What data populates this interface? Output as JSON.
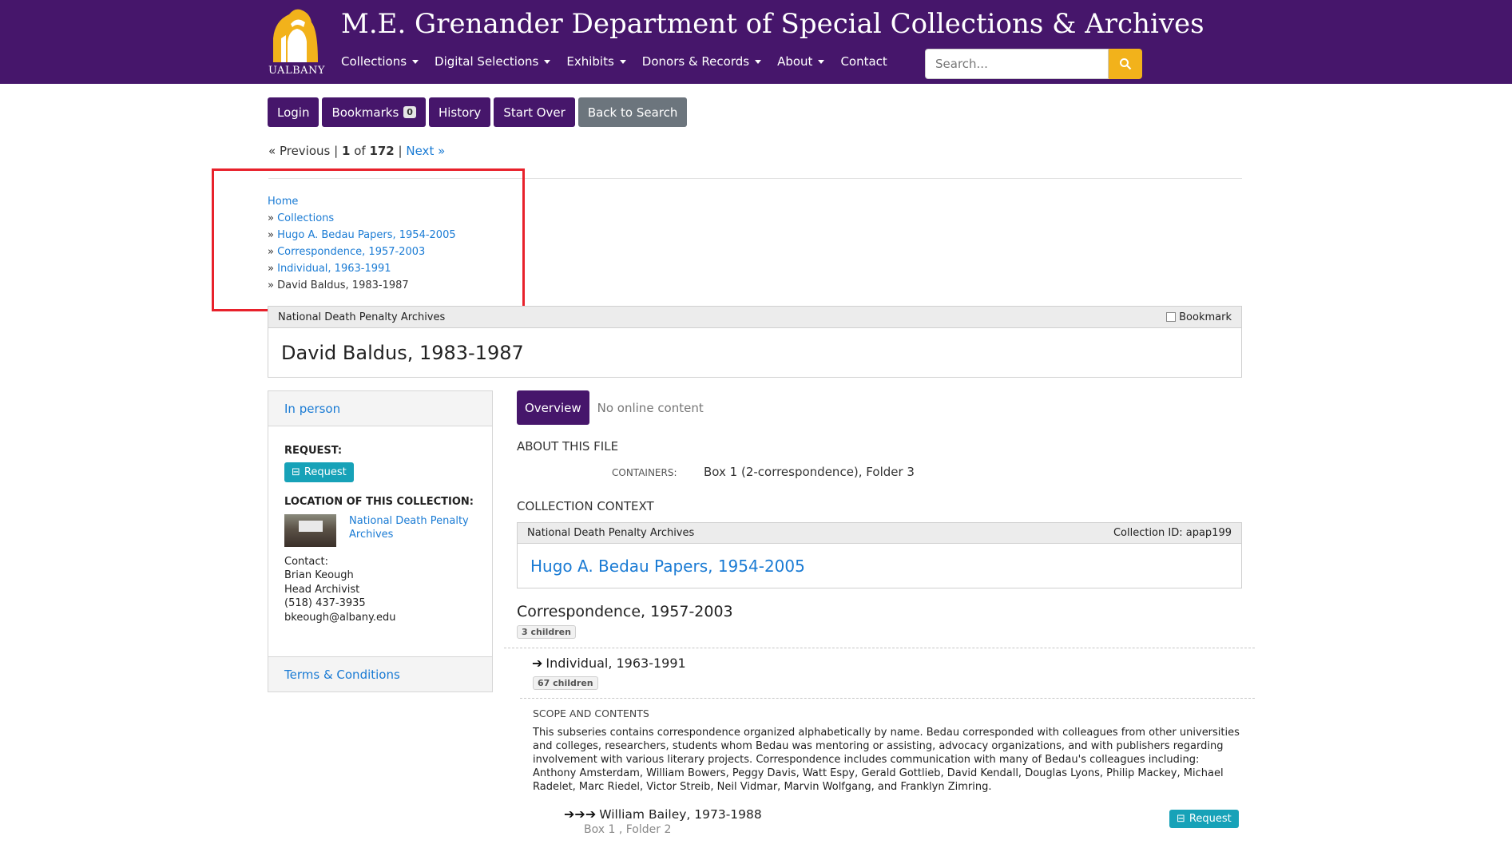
{
  "header": {
    "logo_text": "UALBANY",
    "site_title": "M.E. Grenander Department of Special Collections & Archives",
    "nav": [
      {
        "label": "Collections"
      },
      {
        "label": "Digital Selections"
      },
      {
        "label": "Exhibits"
      },
      {
        "label": "Donors & Records"
      },
      {
        "label": "About"
      },
      {
        "label": "Contact"
      }
    ],
    "search_placeholder": "Search...",
    "colors": {
      "brand": "#46166b",
      "gold": "#f2b21b"
    }
  },
  "toolbar": {
    "login": "Login",
    "bookmarks": "Bookmarks",
    "bookmarks_count": "0",
    "history": "History",
    "start_over": "Start Over",
    "back_to_search": "Back to Search"
  },
  "pager": {
    "previous": "« Previous",
    "sep": "|",
    "current": "1",
    "of": "of",
    "total": "172",
    "next": "Next »"
  },
  "breadcrumb": {
    "home": "Home",
    "sep": "»",
    "items": [
      "Collections",
      "Hugo A. Bedau Papers, 1954-2005",
      "Correspondence, 1957-2003",
      "Individual, 1963-1991"
    ],
    "current": "David Baldus, 1983-1987"
  },
  "record": {
    "repository": "National Death Penalty Archives",
    "bookmark_label": "Bookmark",
    "title": "David Baldus, 1983-1987"
  },
  "sidebar": {
    "tab": "In person",
    "request_label": "REQUEST:",
    "request_button": "Request",
    "location_label": "LOCATION OF THIS COLLECTION:",
    "location_link": "National Death Penalty Archives",
    "contact_label": "Contact:",
    "contact_name": "Brian Keough",
    "contact_title": "Head Archivist",
    "contact_phone": "(518) 437-3935",
    "contact_email": "bkeough@albany.edu",
    "terms": "Terms & Conditions"
  },
  "main": {
    "tab_overview": "Overview",
    "tab_no_online": "No online content",
    "about_heading": "ABOUT THIS FILE",
    "containers_label": "CONTAINERS:",
    "containers_value": "Box 1 (2-correspondence), Folder 3",
    "context_heading": "COLLECTION CONTEXT",
    "context_repo": "National Death Penalty Archives",
    "context_id": "Collection ID: apap199",
    "context_title": "Hugo A. Bedau Papers, 1954-2005",
    "series_title": "Correspondence, 1957-2003",
    "series_children": "3 children",
    "subseries_title": "Individual, 1963-1991",
    "subseries_children": "67 children",
    "scope_heading": "SCOPE AND CONTENTS",
    "scope_text": "This subseries contains correspondence organized alphabetically by name. Bedau corresponded with colleagues from other universities and colleges, researchers, students whom Bedau was mentoring or assisting, advocacy organizations, and with publishers regarding involvement with various literary projects. Correspondence includes communication with many of Bedau's colleagues including: Anthony Amsterdam, William Bowers, Peggy Davis, Watt Espy, Gerald Gottlieb, David Kendall, Douglas Lyons, Philip Mackey, Michael Radelet, Marc Riedel, Victor Streib, Neil Vidmar, Marvin Wolfgang, and Franklyn Zimring.",
    "item_title": "William Bailey, 1973-1988",
    "item_location": "Box 1 , Folder 2",
    "item_request": "Request"
  }
}
